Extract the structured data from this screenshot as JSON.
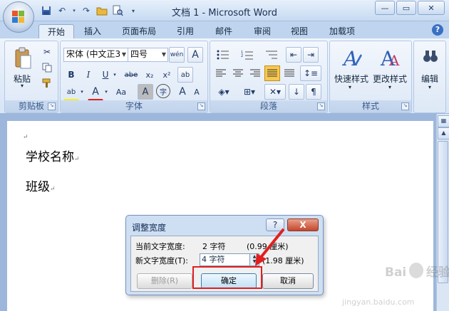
{
  "title_bar": {
    "title": "文档 1 - Microsoft Word",
    "qat_icons": [
      "save-icon",
      "undo-icon",
      "redo-icon",
      "open-folder-icon",
      "print-preview-icon",
      "customize-icon"
    ],
    "controls": [
      "—",
      "▭",
      "✕"
    ]
  },
  "tabs": [
    "开始",
    "插入",
    "页面布局",
    "引用",
    "邮件",
    "审阅",
    "视图",
    "加载项"
  ],
  "active_tab": "开始",
  "help_label": "?",
  "ribbon": {
    "clipboard": {
      "label": "剪贴板",
      "paste_label": "粘贴"
    },
    "font": {
      "label": "字体",
      "font_name": "宋体 (中文正3",
      "font_size": "四号",
      "wen_label": "wén",
      "a_label": "A",
      "bold": "B",
      "italic": "I",
      "underline": "U",
      "strike": "abe",
      "sub": "x₂",
      "sup": "x²",
      "highlight": "ab",
      "font_color": "A",
      "change_case": "Aa",
      "char_shading": "A",
      "enclose": "字",
      "grow": "A",
      "shrink": "A"
    },
    "paragraph": {
      "label": "段落"
    },
    "styles": {
      "label": "样式",
      "quick_styles": "快速样式",
      "change_styles": "更改样式"
    },
    "editing": {
      "label": "编辑"
    }
  },
  "document": {
    "paragraphs": [
      "学校名称",
      "班级"
    ],
    "para_mark": "↵"
  },
  "dialog": {
    "title": "调整宽度",
    "help": "?",
    "close": "X",
    "current_label": "当前文字宽度:",
    "current_value": "2 字符",
    "current_cm": "(0.99 厘米)",
    "new_label": "新文字宽度(T):",
    "new_value": "4 字符",
    "new_cm": "(1.98 厘米)",
    "delete_label": "删除(R)",
    "ok_label": "确定",
    "cancel_label": "取消"
  },
  "watermark": {
    "brand": "Baidu经验",
    "url": "jingyan.baidu.com"
  },
  "colors": {
    "accent_red": "#e02020",
    "ribbon_blue": "#bfd4ee"
  }
}
